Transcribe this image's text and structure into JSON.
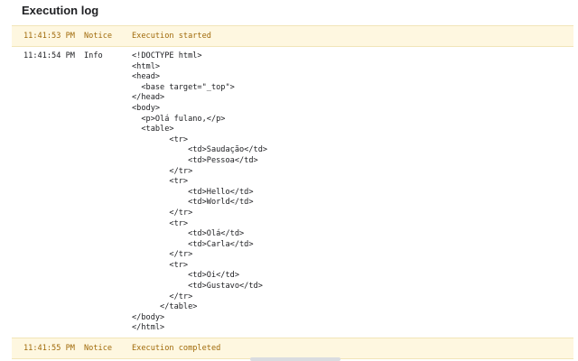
{
  "panel": {
    "title": "Execution log"
  },
  "log": {
    "entries": [
      {
        "time": "11:41:53 PM",
        "level": "Notice",
        "message": "Execution started"
      },
      {
        "time": "11:41:54 PM",
        "level": "Info",
        "message": "<!DOCTYPE html>\n<html>\n<head>\n  <base target=\"_top\">\n</head>\n<body>\n  <p>Olá fulano,</p>\n  <table>\n        <tr>\n            <td>Saudação</td>\n            <td>Pessoa</td>\n        </tr>\n        <tr>\n            <td>Hello</td>\n            <td>World</td>\n        </tr>\n        <tr>\n            <td>Olá</td>\n            <td>Carla</td>\n        </tr>\n        <tr>\n            <td>Oi</td>\n            <td>Gustavo</td>\n        </tr>\n      </table>\n</body>\n</html>"
      },
      {
        "time": "11:41:55 PM",
        "level": "Notice",
        "message": "Execution completed"
      }
    ]
  },
  "colors": {
    "notice_background": "#fef7e0",
    "notice_text": "#a06a0a",
    "info_text": "#202124"
  }
}
